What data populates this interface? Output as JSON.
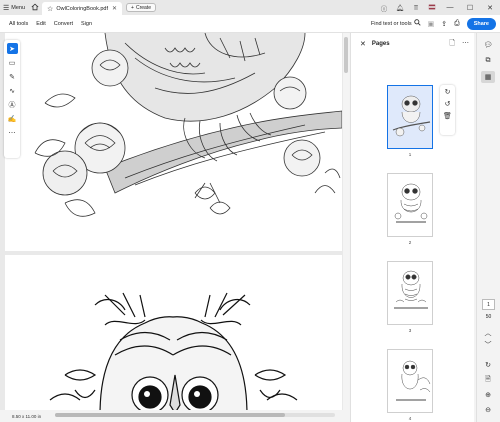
{
  "titlebar": {
    "menu_label": "Menu",
    "tab_title": "OwlColoringBook.pdf",
    "create_label": "Create"
  },
  "menubar": {
    "items": [
      "All tools",
      "Edit",
      "Convert",
      "Sign"
    ],
    "find_label": "Find text or tools",
    "share_label": "Share"
  },
  "statusbar": {
    "page_size": "8.50 x 11.00 in"
  },
  "pages_panel": {
    "title": "Pages",
    "thumbnails": [
      {
        "number": "1"
      },
      {
        "number": "2"
      },
      {
        "number": "3"
      },
      {
        "number": "4"
      }
    ]
  },
  "navigation": {
    "current_page": "1",
    "total_pages": "50"
  },
  "colors": {
    "accent": "#1473e6",
    "selected_thumb": "#dfe9fb"
  }
}
